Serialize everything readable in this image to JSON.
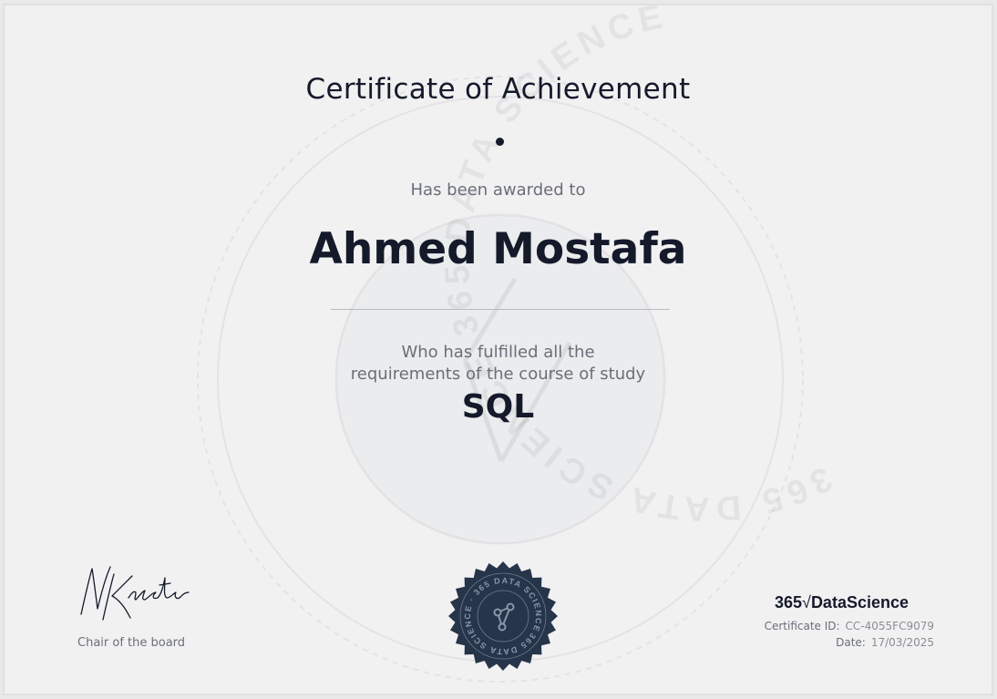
{
  "certificate": {
    "title": "Certificate of Achievement",
    "awarded_text": "Has been awarded to",
    "recipient_name": "Ahmed Mostafa",
    "fulfilled_line1": "Who has fulfilled all the",
    "fulfilled_line2": "requirements of the course of study",
    "course": "SQL"
  },
  "signatory": {
    "signature_text": "NKrastev",
    "role": "Chair of the board"
  },
  "brand": {
    "prefix": "365",
    "tick": "√",
    "name": "DataScience"
  },
  "meta": {
    "certificate_id_label": "Certificate ID:",
    "certificate_id": "CC-4055FC9079",
    "date_label": "Date:",
    "date": "17/03/2025"
  },
  "watermark_text": "365 DATA SCIENCE 365 DATA SCIENCE",
  "seal_text": "365 DATA SCIENCE · 365 DATA SCIENCE ·",
  "colors": {
    "ink": "#151a2b",
    "muted": "#6b6e79",
    "paper": "#f1f1f2",
    "seal": "#26354a"
  }
}
